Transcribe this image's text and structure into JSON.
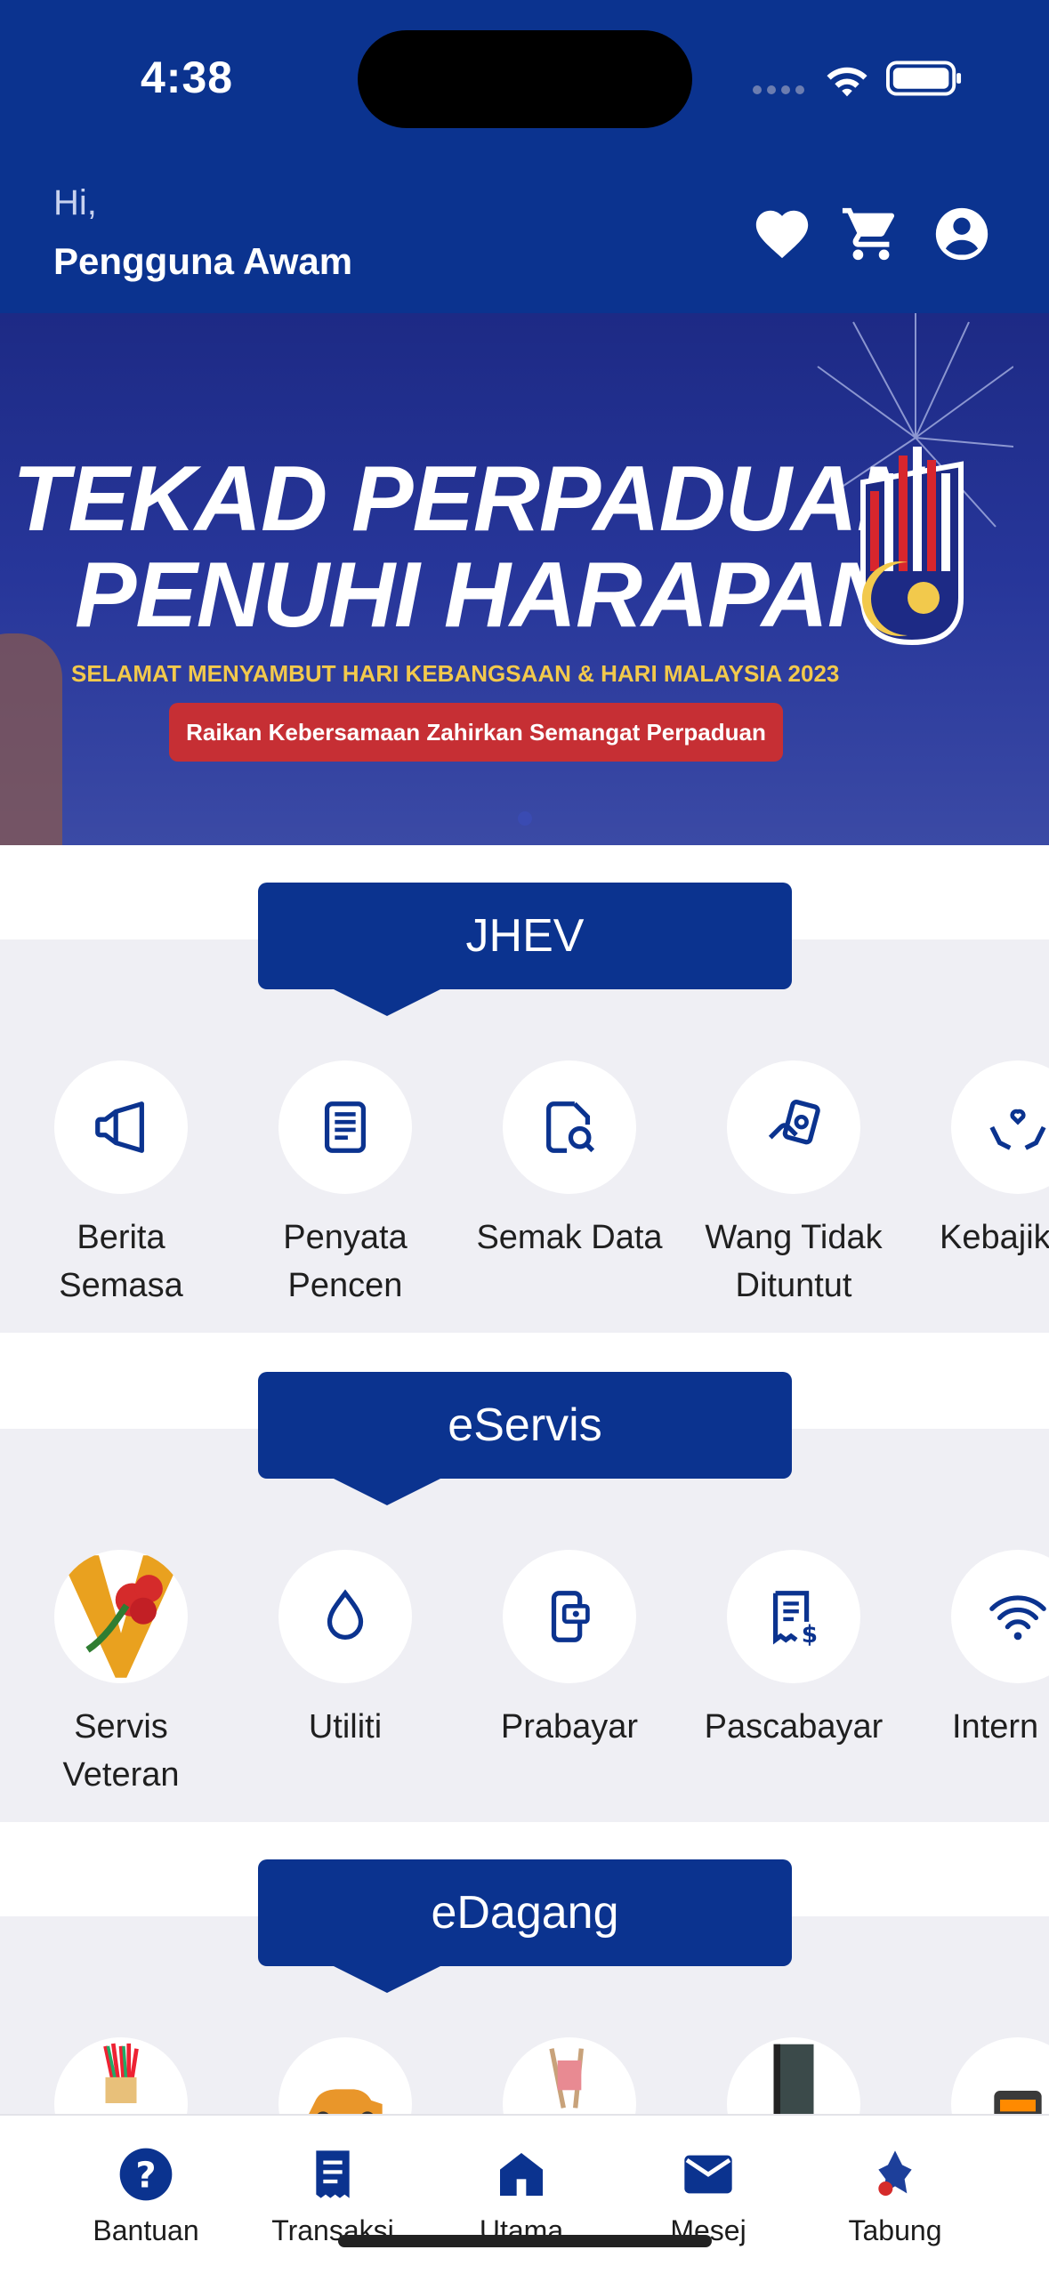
{
  "status_bar": {
    "time": "4:38"
  },
  "header": {
    "greeting": "Hi,",
    "user_name": "Pengguna Awam",
    "icons": [
      "heart-icon",
      "cart-icon",
      "account-icon"
    ],
    "bg_color": "#0b338f"
  },
  "banner": {
    "line1": "TEKAD PERPADUAN",
    "line2": "PENUHI HARAPAN",
    "subtitle": "SELAMAT MENYAMBUT HARI KEBANGSAAN & HARI MALAYSIA 2023",
    "pill_text": "Raikan Kebersamaan Zahirkan Semangat Perpaduan"
  },
  "sections": {
    "jhev": {
      "title": "JHEV",
      "items": [
        {
          "label1": "Berita",
          "label2": "Semasa",
          "icon": "megaphone-icon"
        },
        {
          "label1": "Penyata",
          "label2": "Pencen",
          "icon": "document-icon"
        },
        {
          "label1": "Semak Data",
          "label2": "",
          "icon": "file-search-icon"
        },
        {
          "label1": "Wang Tidak",
          "label2": "Dituntut",
          "icon": "money-hand-icon"
        },
        {
          "label1": "Kebajik",
          "label2": "",
          "icon": "care-hands-icon"
        }
      ]
    },
    "eservis": {
      "title": "eServis",
      "items": [
        {
          "label1": "Servis",
          "label2": "Veteran",
          "icon": "veteran-logo-icon"
        },
        {
          "label1": "Utiliti",
          "label2": "",
          "icon": "water-drop-icon"
        },
        {
          "label1": "Prabayar",
          "label2": "",
          "icon": "prepaid-phone-icon"
        },
        {
          "label1": "Pascabayar",
          "label2": "",
          "icon": "bill-icon"
        },
        {
          "label1": "Intern",
          "label2": "",
          "icon": "wifi-icon"
        }
      ]
    },
    "edagang": {
      "title": "eDagang",
      "items": [
        {
          "icon": "pencils-product-icon"
        },
        {
          "icon": "car-product-icon"
        },
        {
          "icon": "chair-product-icon"
        },
        {
          "icon": "book-product-icon"
        },
        {
          "icon": "machine-product-icon"
        }
      ]
    }
  },
  "bottom_nav": {
    "items": [
      {
        "label": "Bantuan",
        "icon": "help-icon"
      },
      {
        "label": "Transaksi",
        "icon": "receipt-icon"
      },
      {
        "label": "Utama",
        "icon": "home-icon"
      },
      {
        "label": "Mesej",
        "icon": "mail-icon"
      },
      {
        "label": "Tabung",
        "icon": "tabung-logo-icon"
      }
    ]
  },
  "colors": {
    "primary": "#0b338f",
    "section_bg": "#efeff4",
    "banner_red": "#c62f34",
    "banner_gold": "#f2c94c"
  }
}
